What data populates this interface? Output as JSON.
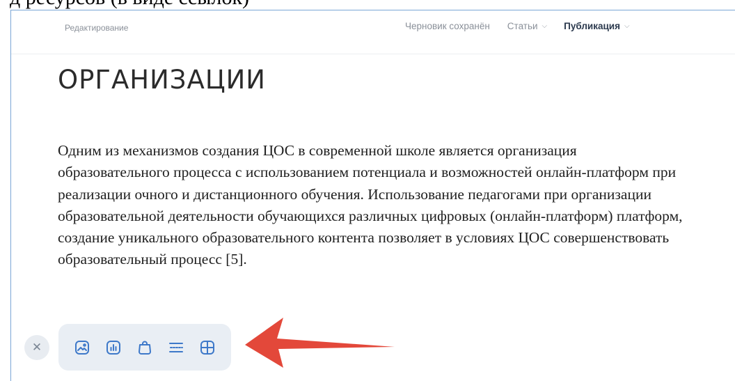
{
  "header_fragment": "д ресурсов (в виде ссылок)",
  "topbar": {
    "mode_label": "Редактирование",
    "draft_status": "Черновик сохранён",
    "articles_label": "Статьи",
    "publish_label": "Публикация"
  },
  "article": {
    "heading": "ОРГАНИЗАЦИИ",
    "paragraph": " Одним из механизмов создания ЦОС в современной школе является организация образовательного процесса с использованием потенциала и возможностей онлайн-платформ при реализации очного и дистанционного обучения. Использование педагогами при организации образовательной деятельности обучающихся различных цифровых (онлайн-платформ) платформ, создание уникального образовательного контента позволяет в условиях ЦОС совершенствовать образовательный процесс [5]."
  },
  "toolbar": {
    "close_glyph": "✕",
    "icons": [
      "image-icon",
      "chart-icon",
      "product-icon",
      "separator-icon",
      "table-icon"
    ]
  },
  "colors": {
    "accent_icon": "#3d78c9",
    "arrow": "#e3483a",
    "toolbar_bg": "#e9eef4",
    "frame_border": "#7aa6d6"
  }
}
